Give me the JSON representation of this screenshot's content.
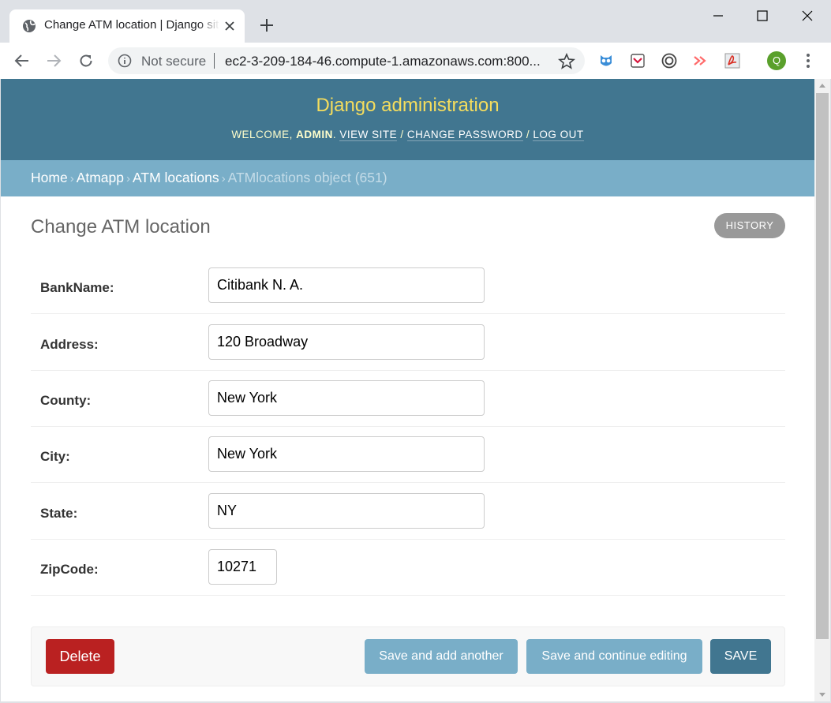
{
  "browser": {
    "tab_title": "Change ATM location | Django site admin",
    "security_label": "Not secure",
    "url": "ec2-3-209-184-46.compute-1.amazonaws.com:800...",
    "profile_initial": "Q"
  },
  "header": {
    "branding": "Django administration",
    "welcome": "Welcome,",
    "username": "Admin",
    "view_site": "View site",
    "change_password": "Change password",
    "log_out": "Log out"
  },
  "breadcrumbs": {
    "home": "Home",
    "app": "Atmapp",
    "model": "ATM locations",
    "current": "ATMlocations object (651)"
  },
  "content": {
    "title": "Change ATM location",
    "history": "History"
  },
  "form": {
    "bankname": {
      "label": "BankName:",
      "value": "Citibank N. A."
    },
    "address": {
      "label": "Address:",
      "value": "120 Broadway"
    },
    "county": {
      "label": "County:",
      "value": "New York"
    },
    "city": {
      "label": "City:",
      "value": "New York"
    },
    "state": {
      "label": "State:",
      "value": "NY"
    },
    "zipcode": {
      "label": "ZipCode:",
      "value": "10271"
    }
  },
  "submit": {
    "delete": "Delete",
    "save_add_another": "Save and add another",
    "save_continue": "Save and continue editing",
    "save": "SAVE"
  },
  "colors": {
    "header": "#417690",
    "branding": "#f5dd5d",
    "breadcrumbs": "#79aec8",
    "delete": "#ba2121"
  }
}
